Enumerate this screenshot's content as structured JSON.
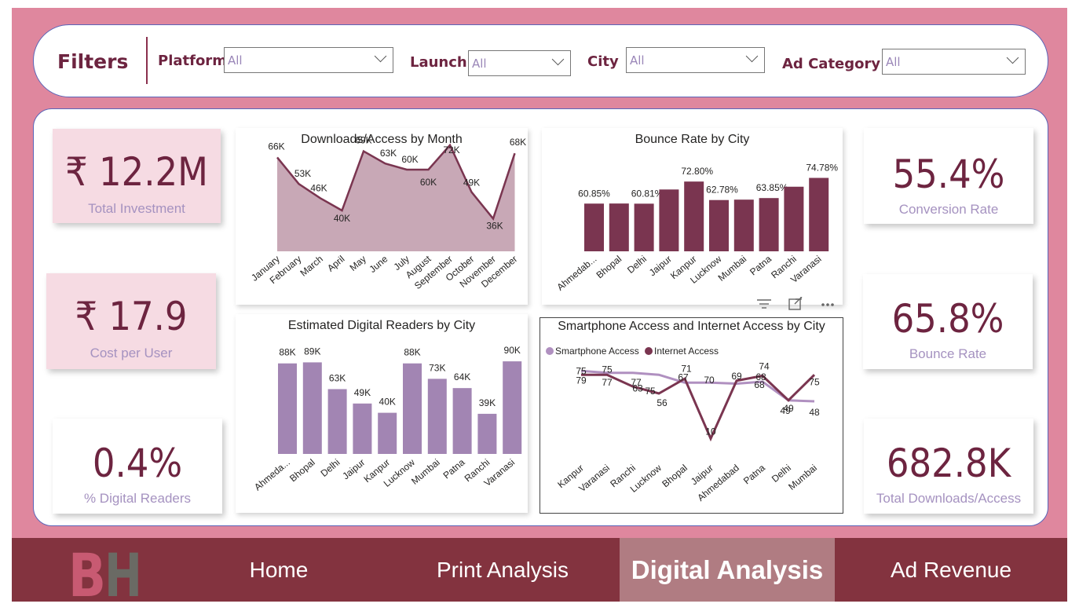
{
  "filters": {
    "title": "Filters",
    "items": [
      {
        "label": "Platform",
        "value": "All"
      },
      {
        "label": "Launch",
        "value": "All"
      },
      {
        "label": "City",
        "value": "All"
      },
      {
        "label": "Ad Category",
        "value": "All"
      }
    ]
  },
  "kpis": {
    "total_investment": {
      "value": "₹ 12.2M",
      "label": "Total Investment"
    },
    "cost_per_user": {
      "value": "₹ 17.9",
      "label": "Cost per User"
    },
    "digital_readers": {
      "value": "0.4%",
      "label": "% Digital Readers"
    },
    "conversion_rate": {
      "value": "55.4%",
      "label": "Conversion Rate"
    },
    "bounce_rate": {
      "value": "65.8%",
      "label": "Bounce Rate"
    },
    "total_downloads": {
      "value": "682.8K",
      "label": "Total Downloads/Access"
    }
  },
  "colors": {
    "frame": "#df879e",
    "accent": "#6d2440",
    "area_fill": "#c8a8b6",
    "bar_dark": "#7a3550",
    "bar_light": "#a285b3",
    "line_light": "#b090c0",
    "nav": "#83333f",
    "nav_active": "#b07c82"
  },
  "chart_data": [
    {
      "id": "downloads",
      "type": "area",
      "title": "Downloads/Access by Month",
      "categories": [
        "January",
        "February",
        "March",
        "April",
        "May",
        "June",
        "July",
        "August",
        "September",
        "October",
        "November",
        "December"
      ],
      "values": [
        66,
        53,
        46,
        40,
        69,
        63,
        60,
        60,
        72,
        49,
        36,
        68
      ],
      "labels": [
        "66K",
        "53K",
        "46K",
        "40K",
        "69K",
        "63K",
        "60K",
        "60K",
        "72K",
        "49K",
        "36K",
        "68K"
      ]
    },
    {
      "id": "bounce",
      "type": "bar",
      "title": "Bounce Rate by City",
      "categories": [
        "Ahmedab...",
        "Bhopal",
        "Delhi",
        "Jaipur",
        "Kanpur",
        "Lucknow",
        "Mumbai",
        "Patna",
        "Ranchi",
        "Varanasi"
      ],
      "values": [
        60.85,
        60.9,
        60.81,
        68.5,
        72.8,
        62.78,
        63.0,
        63.85,
        70.0,
        74.78
      ],
      "labels": [
        "60.85%",
        "",
        "60.81%",
        "",
        "72.80%",
        "62.78%",
        "",
        "63.85%",
        "",
        "74.78%"
      ]
    },
    {
      "id": "readers",
      "type": "bar",
      "title": "Estimated Digital Readers by City",
      "categories": [
        "Ahmeda...",
        "Bhopal",
        "Delhi",
        "Jaipur",
        "Kanpur",
        "Lucknow",
        "Mumbai",
        "Patna",
        "Ranchi",
        "Varanasi"
      ],
      "values": [
        88,
        89,
        63,
        49,
        40,
        88,
        73,
        64,
        39,
        90
      ],
      "labels": [
        "88K",
        "89K",
        "63K",
        "49K",
        "40K",
        "88K",
        "73K",
        "64K",
        "39K",
        "90K"
      ]
    },
    {
      "id": "access",
      "type": "line",
      "title": "Smartphone Access and Internet Access by City",
      "categories": [
        "Kanpur",
        "Varanasi",
        "Ranchi",
        "Lucknow",
        "Bhopal",
        "Jaipur",
        "Ahmedabad",
        "Patna",
        "Delhi",
        "Mumbai"
      ],
      "series": [
        {
          "name": "Smartphone Access",
          "values": [
            79,
            77,
            77,
            75,
            67,
            67,
            66,
            68,
            49,
            48
          ],
          "labels": [
            "79",
            "77",
            "77",
            "",
            "67",
            "",
            "",
            "68",
            "49",
            "48"
          ]
        },
        {
          "name": "Internet Access",
          "values": [
            75,
            75,
            63,
            56,
            71,
            10,
            69,
            74,
            49,
            75
          ],
          "labels": [
            "75",
            "75",
            "63",
            "56",
            "71",
            "10",
            "69",
            "74",
            "49",
            "75"
          ]
        }
      ],
      "extra_labels": [
        "75",
        "70",
        "68"
      ]
    }
  ],
  "nav": {
    "logo": "BH",
    "items": [
      "Home",
      "Print Analysis",
      "Digital Analysis",
      "Ad Revenue"
    ],
    "active": "Digital Analysis"
  }
}
